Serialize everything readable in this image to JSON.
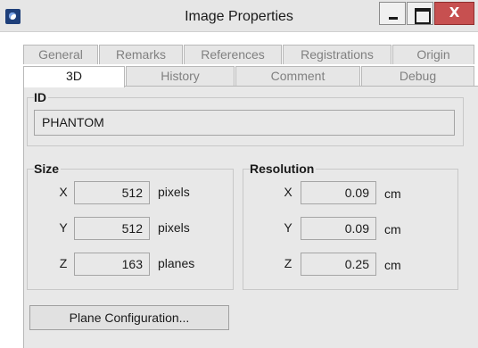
{
  "window": {
    "title": "Image Properties",
    "icon": "app-icon",
    "controls": {
      "minimize": "minimize",
      "maximize": "maximize",
      "close": "X"
    }
  },
  "tabs": {
    "row_back": [
      "General",
      "Remarks",
      "References",
      "Registrations",
      "Origin"
    ],
    "row_front": [
      "3D",
      "History",
      "Comment",
      "Debug"
    ],
    "active": "3D"
  },
  "id_group": {
    "title": "ID",
    "value": "PHANTOM"
  },
  "size_group": {
    "title": "Size",
    "rows": [
      {
        "axis": "X",
        "value": "512",
        "unit": "pixels"
      },
      {
        "axis": "Y",
        "value": "512",
        "unit": "pixels"
      },
      {
        "axis": "Z",
        "value": "163",
        "unit": "planes"
      }
    ]
  },
  "resolution_group": {
    "title": "Resolution",
    "rows": [
      {
        "axis": "X",
        "value": "0.09",
        "unit": "cm"
      },
      {
        "axis": "Y",
        "value": "0.09",
        "unit": "cm"
      },
      {
        "axis": "Z",
        "value": "0.25",
        "unit": "cm"
      }
    ]
  },
  "buttons": {
    "plane_configuration": "Plane Configuration..."
  }
}
